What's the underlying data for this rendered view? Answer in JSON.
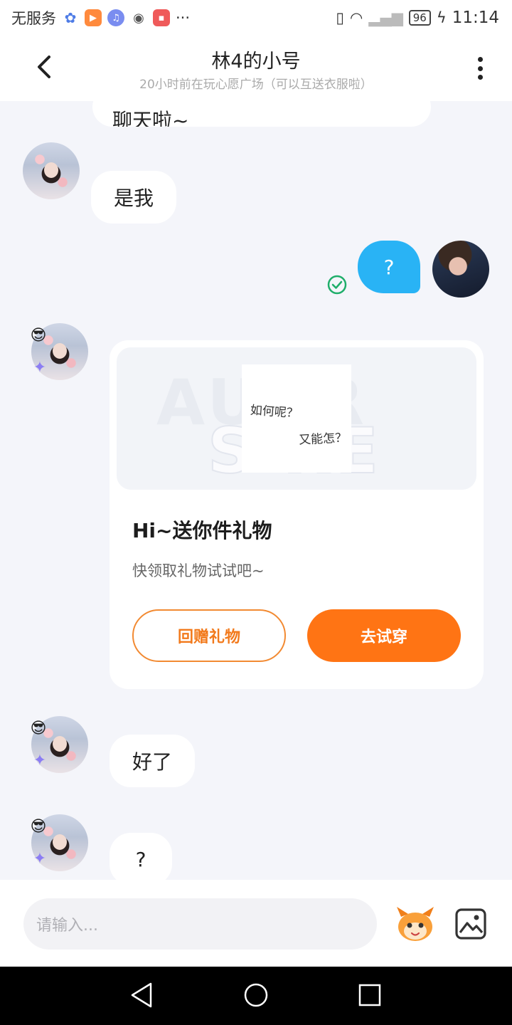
{
  "status_bar": {
    "carrier": "无服务",
    "battery": "96",
    "time": "11:14"
  },
  "header": {
    "title": "林4的小号",
    "subtitle": "20小时前在玩心愿广场（可以互送衣服啦）"
  },
  "messages": {
    "cut_off_text": "聊天啦~",
    "m1": "是我",
    "m2": "?",
    "m3": "好了",
    "m4": "?"
  },
  "gift_card": {
    "image_text_line1": "如何呢？",
    "image_text_line2": "又能怎？",
    "image_bg_word1": "AU  IR",
    "image_bg_word2": "S  RE",
    "title": "Hi~送你件礼物",
    "description": "快领取礼物试试吧~",
    "return_gift_label": "回赠礼物",
    "try_on_label": "去试穿"
  },
  "input": {
    "placeholder": "请输入..."
  },
  "colors": {
    "accent_orange": "#ff7414",
    "my_bubble_blue": "#29b3f5",
    "read_check_green": "#1fae6a"
  },
  "icons": {
    "back": "chevron-left-icon",
    "more": "vertical-dots-icon",
    "emoji": "mascot-emoji-icon",
    "image": "image-picture-icon"
  }
}
